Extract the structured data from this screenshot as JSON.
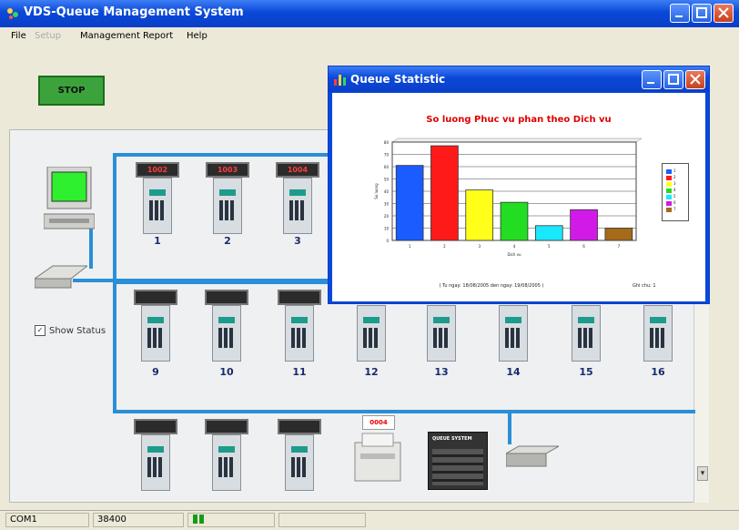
{
  "app": {
    "title": "VDS-Queue Management System"
  },
  "menu": {
    "items": [
      {
        "label": "File",
        "enabled": true
      },
      {
        "label": "Setup",
        "enabled": false
      },
      {
        "label": "Management",
        "enabled": true
      },
      {
        "label": "Report",
        "enabled": true
      },
      {
        "label": "Help",
        "enabled": true
      }
    ]
  },
  "stop_button": {
    "label": "STOP"
  },
  "show_status": {
    "label": "Show Status",
    "checked": true,
    "mark": "✓"
  },
  "terminals": [
    {
      "num": "1",
      "display": "1002"
    },
    {
      "num": "2",
      "display": "1003"
    },
    {
      "num": "3",
      "display": "1004"
    },
    {
      "num": "9",
      "display": ""
    },
    {
      "num": "10",
      "display": ""
    },
    {
      "num": "11",
      "display": ""
    },
    {
      "num": "12",
      "display": ""
    },
    {
      "num": "13",
      "display": ""
    },
    {
      "num": "14",
      "display": ""
    },
    {
      "num": "15",
      "display": ""
    },
    {
      "num": "16",
      "display": ""
    },
    {
      "num": "",
      "display": ""
    },
    {
      "num": "",
      "display": ""
    },
    {
      "num": "",
      "display": ""
    }
  ],
  "printer": {
    "display": "0004"
  },
  "queue_system": {
    "label": "QUEUE SYSTEM"
  },
  "statusbar": {
    "port": "COM1",
    "baud": "38400"
  },
  "child": {
    "title": "Queue Statistic",
    "chart_title": "So luong Phuc vu phan theo Dich vu",
    "caption": "( Tu ngay: 18/08/2005 den ngay: 19/08/2005 )",
    "caption2": "Ghi chu: 1"
  },
  "chart_data": {
    "type": "bar",
    "title": "So luong Phuc vu phan theo Dich vu",
    "xlabel": "Dich vu",
    "ylabel": "So luong",
    "categories": [
      "1",
      "2",
      "3",
      "4",
      "5",
      "6",
      "7"
    ],
    "values": [
      61,
      77,
      41,
      31,
      12,
      25,
      10
    ],
    "colors": [
      "#1a5cff",
      "#ff1a1a",
      "#ffff1a",
      "#22dd22",
      "#1ae8ff",
      "#d21ae8",
      "#a56a1a"
    ],
    "yticks": [
      "0",
      "10",
      "20",
      "30",
      "40",
      "50",
      "60",
      "70",
      "80"
    ],
    "ylim": [
      0,
      80
    ],
    "legend": "right",
    "grid": true
  },
  "colors": {
    "title_bar": "#0a48d8",
    "network": "#2a8fd6",
    "stop": "#3ca33c"
  }
}
